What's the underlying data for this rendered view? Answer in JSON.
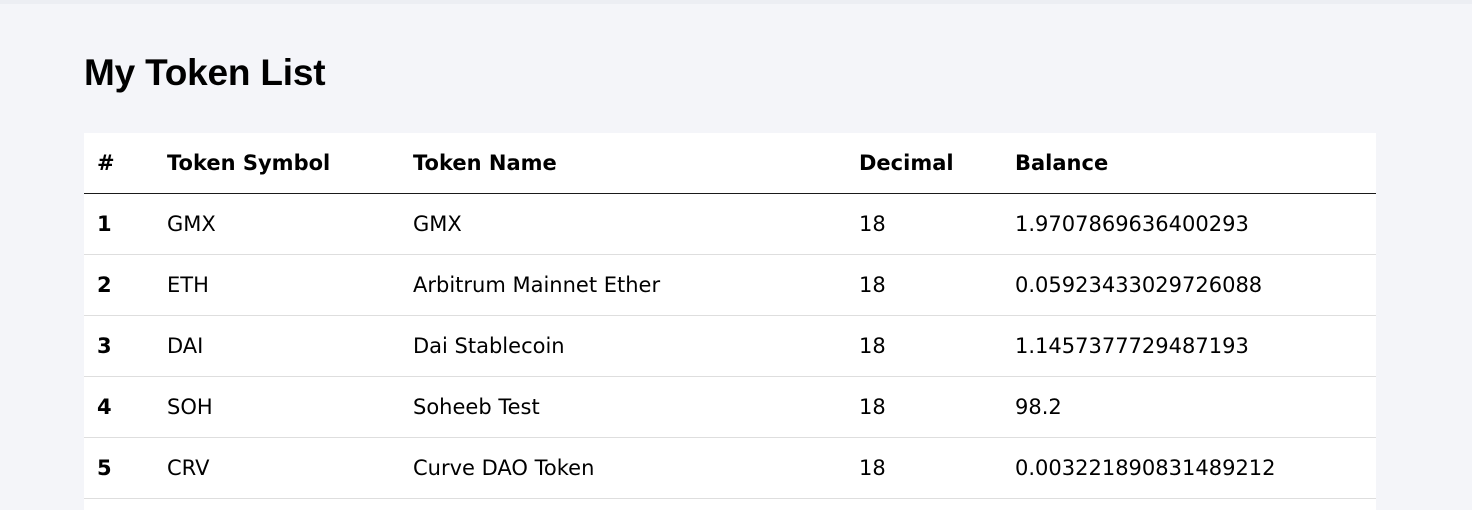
{
  "page": {
    "title": "My Token List"
  },
  "table": {
    "headers": {
      "index": "#",
      "symbol": "Token Symbol",
      "name": "Token Name",
      "decimal": "Decimal",
      "balance": "Balance"
    },
    "rows": [
      {
        "index": "1",
        "symbol": "GMX",
        "name": "GMX",
        "decimal": "18",
        "balance": "1.9707869636400293"
      },
      {
        "index": "2",
        "symbol": "ETH",
        "name": "Arbitrum Mainnet Ether",
        "decimal": "18",
        "balance": "0.05923433029726088"
      },
      {
        "index": "3",
        "symbol": "DAI",
        "name": "Dai Stablecoin",
        "decimal": "18",
        "balance": "1.1457377729487193"
      },
      {
        "index": "4",
        "symbol": "SOH",
        "name": "Soheeb Test",
        "decimal": "18",
        "balance": "98.2"
      },
      {
        "index": "5",
        "symbol": "CRV",
        "name": "Curve DAO Token",
        "decimal": "18",
        "balance": "0.003221890831489212"
      }
    ]
  }
}
